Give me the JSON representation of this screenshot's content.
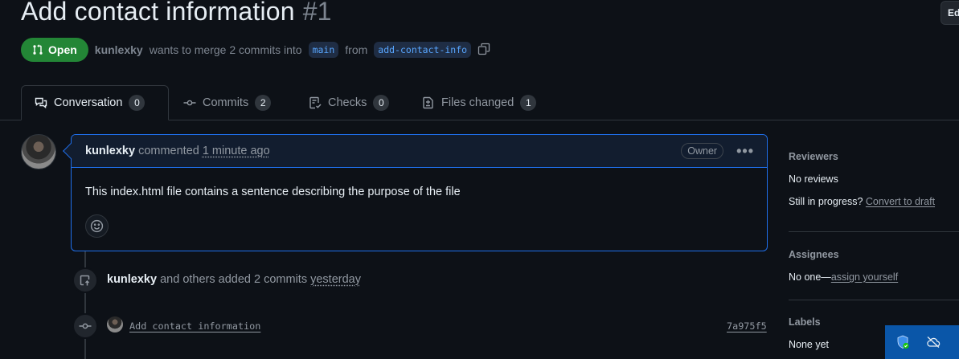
{
  "header": {
    "title": "Add contact information",
    "number": "#1",
    "edit_label": "Ed"
  },
  "state": {
    "label": "Open",
    "author": "kunlexky",
    "text_merge": "wants to merge 2 commits into",
    "base_branch": "main",
    "text_from": "from",
    "head_branch": "add-contact-info"
  },
  "tabs": [
    {
      "label": "Conversation",
      "count": "0",
      "icon": "comment-discussion-icon"
    },
    {
      "label": "Commits",
      "count": "2",
      "icon": "git-commit-icon"
    },
    {
      "label": "Checks",
      "count": "0",
      "icon": "checklist-icon"
    },
    {
      "label": "Files changed",
      "count": "1",
      "icon": "file-diff-icon"
    }
  ],
  "comment": {
    "author": "kunlexky",
    "verb": "commented",
    "time": "1 minute ago",
    "role": "Owner",
    "more": "•••",
    "body": "This index.html file contains a sentence describing the purpose of the file"
  },
  "timeline": {
    "event_author": "kunlexky",
    "event_text": "and others added 2 commits",
    "event_time": "yesterday",
    "commit_message": "Add contact information",
    "commit_sha": "7a975f5"
  },
  "sidebar": {
    "reviewers": {
      "heading": "Reviewers",
      "value": "No reviews",
      "progress_text": "Still in progress?",
      "progress_link": "Convert to draft"
    },
    "assignees": {
      "heading": "Assignees",
      "value": "No one—",
      "link": "assign yourself"
    },
    "labels": {
      "heading": "Labels",
      "value": "None yet"
    }
  },
  "colors": {
    "background": "#0d1117",
    "open_green": "#238636",
    "accent_blue": "#1f6feb",
    "branch_text": "#58a6ff"
  }
}
